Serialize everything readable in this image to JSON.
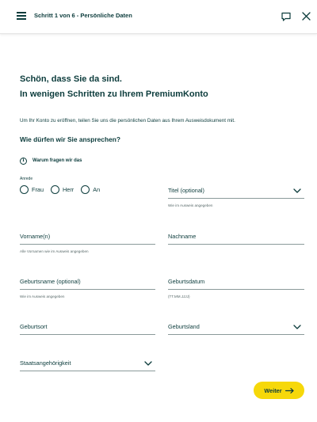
{
  "header": {
    "step_title": "Schritt 1 von 6 - Persönliche Daten",
    "icons": {
      "menu": "hamburger-menu-icon",
      "chat": "chat-icon",
      "close": "close-icon"
    }
  },
  "intro": {
    "headline_line1": "Schön, dass Sie da sind.",
    "headline_line2": "In wenigen Schritten zu Ihrem PremiumKonto",
    "description": "Um Ihr Konto zu eröffnen, teilen Sie uns die persönlichen Daten aus Ihrem Ausweisdokument mit.",
    "question": "Wie dürfen wir Sie ansprechen?",
    "info_link": "Warum fragen wir das"
  },
  "form": {
    "anrede": {
      "label": "Anrede",
      "options": [
        {
          "label": "Frau",
          "selected": false
        },
        {
          "label": "Herr",
          "selected": false
        },
        {
          "label": "An",
          "selected": false
        }
      ]
    },
    "titel": {
      "label": "Titel (optional)",
      "hint": "Wie im Ausweis angegeben"
    },
    "vorname": {
      "label": "Vorname(n)",
      "hint": "Alle Vornamen wie im Ausweis angegeben"
    },
    "nachname": {
      "label": "Nachname"
    },
    "geburtsname": {
      "label": "Geburtsname (optional)",
      "hint": "Wie im Ausweis angegeben"
    },
    "geburtsdatum": {
      "label": "Geburtsdatum",
      "hint": "(TT.MM.JJJJ)"
    },
    "geburtsort": {
      "label": "Geburtsort"
    },
    "geburtsland": {
      "label": "Geburtsland"
    },
    "staatsangehoerigkeit": {
      "label": "Staatsangehörigkeit"
    }
  },
  "actions": {
    "next_label": "Weiter"
  },
  "colors": {
    "text": "#0c3c3c",
    "accent": "#f6d80a",
    "border": "#8a9a9a"
  }
}
